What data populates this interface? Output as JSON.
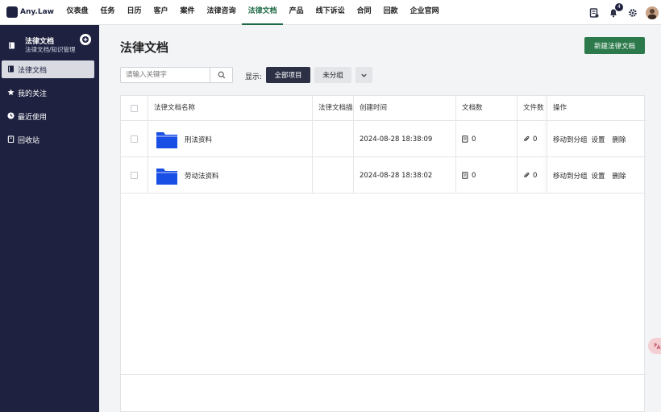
{
  "app": {
    "logo_text": "Any.Law"
  },
  "nav": {
    "items": [
      {
        "label": "仪表盘",
        "active": false
      },
      {
        "label": "任务",
        "active": false
      },
      {
        "label": "日历",
        "active": false
      },
      {
        "label": "客户",
        "active": false
      },
      {
        "label": "案件",
        "active": false
      },
      {
        "label": "法律咨询",
        "active": false
      },
      {
        "label": "法律文档",
        "active": true
      },
      {
        "label": "产品",
        "active": false
      },
      {
        "label": "线下诉讼",
        "active": false
      },
      {
        "label": "合同",
        "active": false
      },
      {
        "label": "回款",
        "active": false
      },
      {
        "label": "企业官网",
        "active": false
      }
    ],
    "notification_count": "4"
  },
  "sidebar": {
    "title": "法律文档",
    "subtitle": "法律文档/知识管理",
    "items": [
      {
        "label": "法律文档",
        "icon": "book-icon",
        "active": true
      },
      {
        "label": "我的关注",
        "icon": "star-icon",
        "active": false
      },
      {
        "label": "最近使用",
        "icon": "clock-icon",
        "active": false
      },
      {
        "label": "回收站",
        "icon": "trash-icon",
        "active": false
      }
    ]
  },
  "main": {
    "title": "法律文档",
    "new_button": "新建法律文档",
    "search_placeholder": "请输入关键字",
    "show_label": "显示:",
    "filter_all": "全部项目",
    "filter_ungrouped": "未分组"
  },
  "table": {
    "columns": [
      "法律文档名称",
      "法律文档描述",
      "创建时间",
      "文档数",
      "文件数",
      "操作"
    ],
    "rows": [
      {
        "name": "刑法资料",
        "desc": "",
        "created": "2024-08-28 18:38:09",
        "docs": "0",
        "files": "0"
      },
      {
        "name": "劳动法资料",
        "desc": "",
        "created": "2024-08-28 18:38:02",
        "docs": "0",
        "files": "0"
      }
    ],
    "actions": [
      "移动到分组",
      "设置",
      "删除"
    ]
  },
  "colors": {
    "sidebar_bg": "#1e2240",
    "accent_green": "#2c7a4b",
    "folder_blue": "#1a4fe6"
  }
}
